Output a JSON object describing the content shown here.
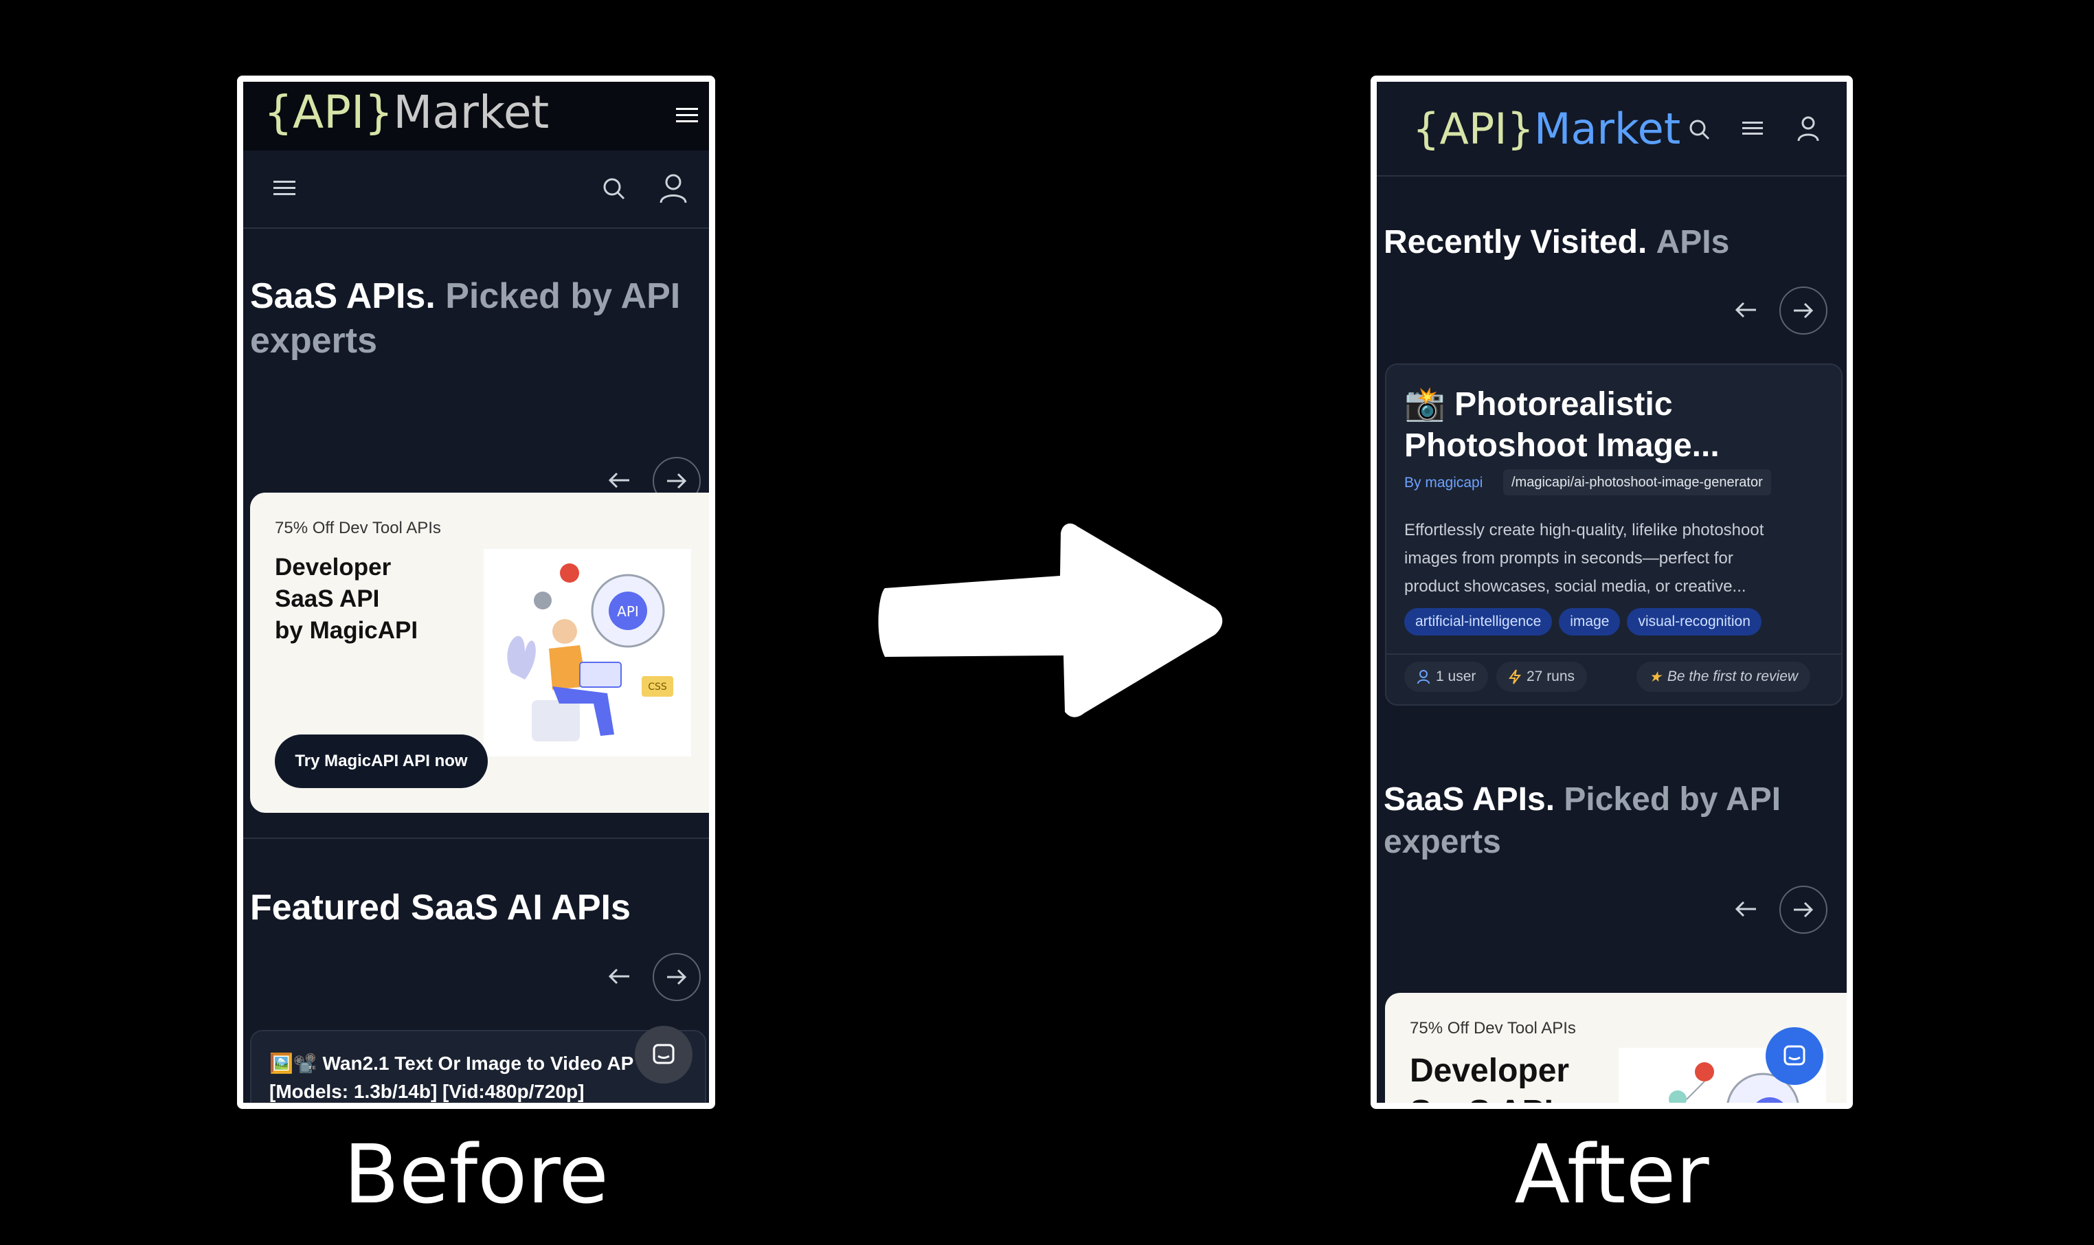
{
  "logo": {
    "open_brace": "{",
    "api": "API",
    "close_brace": "}",
    "market": "Market"
  },
  "before": {
    "section1": {
      "title_white": "SaaS APIs.",
      "title_grey": "Picked by API experts"
    },
    "promo": {
      "eyebrow": "75% Off Dev Tool APIs",
      "title_lines": [
        "Developer",
        "SaaS API",
        "by MagicAPI"
      ],
      "cta": "Try MagicAPI API now",
      "illus_badge": "API",
      "illus_tag": "CSS"
    },
    "section2": {
      "title": "Featured SaaS AI APIs"
    },
    "card_peek": {
      "emoji": "🖼️📽️",
      "line1": "Wan2.1 Text Or Image to Video AP",
      "line2": "[Models: 1.3b/14b] [Vid:480p/720p]"
    }
  },
  "after": {
    "recent": {
      "title_white": "Recently Visited.",
      "title_grey": "APIs"
    },
    "card": {
      "emoji": "📸",
      "title_line1": "Photorealistic",
      "title_line2": "Photoshoot Image...",
      "author": "By magicapi",
      "slug": "/magicapi/ai-photoshoot-image-generator",
      "desc_lines": [
        "Effortlessly create high-quality, lifelike photoshoot",
        "images from prompts in seconds—perfect for",
        "product showcases, social media, or creative..."
      ],
      "tags": [
        "artificial-intelligence",
        "image",
        "visual-recognition"
      ],
      "users": "1 user",
      "runs": "27 runs",
      "review": "Be the first to review"
    },
    "section1": {
      "title_white": "SaaS APIs.",
      "title_grey": "Picked by API experts"
    },
    "promo": {
      "eyebrow": "75% Off Dev Tool APIs",
      "title_line1": "Developer",
      "title_line2": "SaaS API"
    }
  },
  "captions": {
    "before": "Before",
    "after": "After"
  },
  "colors": {
    "accent_blue": "#5aa0ff",
    "logo_green": "#d7e4a7",
    "tag_blue": "#1b3a8f",
    "chat_blue": "#2f6ee8"
  }
}
